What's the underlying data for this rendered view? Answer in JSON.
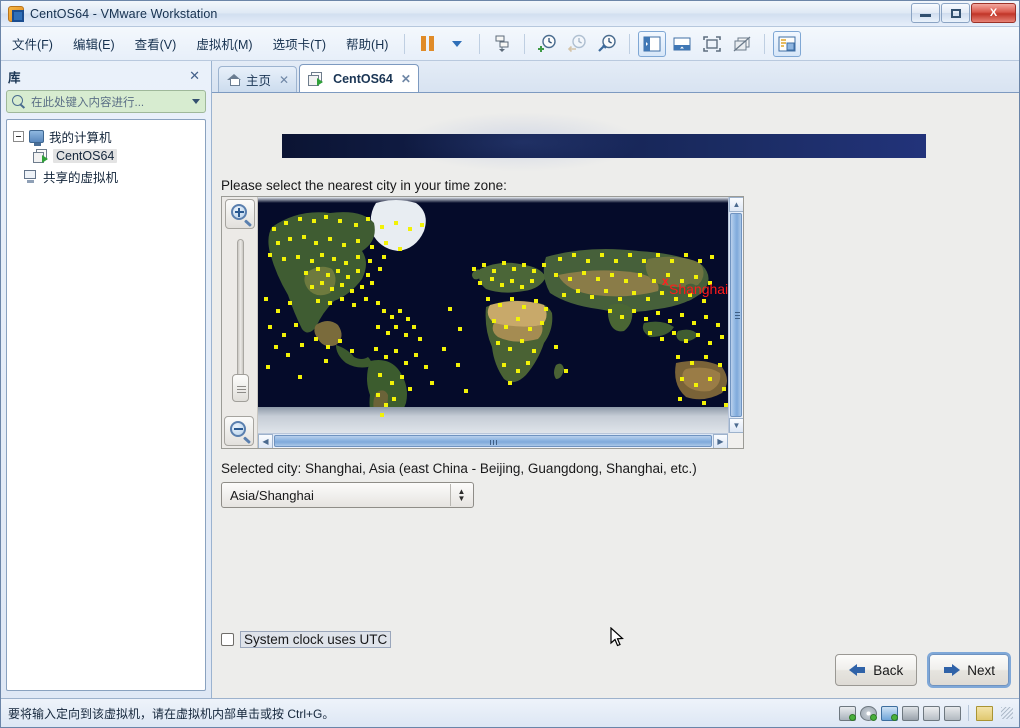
{
  "window": {
    "title": "CentOS64 - VMware Workstation",
    "app_icon": "vmware-icon",
    "minimize_label": "Minimize",
    "maximize_label": "Maximize",
    "close_label": "X"
  },
  "menubar": {
    "items": [
      {
        "label": "文件(F)",
        "name": "menu-file"
      },
      {
        "label": "编辑(E)",
        "name": "menu-edit"
      },
      {
        "label": "查看(V)",
        "name": "menu-view"
      },
      {
        "label": "虚拟机(M)",
        "name": "menu-vm"
      },
      {
        "label": "选项卡(T)",
        "name": "menu-tabs"
      },
      {
        "label": "帮助(H)",
        "name": "menu-help"
      }
    ],
    "toolbar": [
      {
        "name": "pause-button",
        "label": "Pause"
      },
      {
        "name": "pause-dropdown",
        "label": "Pause options"
      },
      {
        "name": "snapshot-take-button",
        "label": "Take snapshot"
      },
      {
        "name": "snapshot-add-button",
        "label": "Add snapshot"
      },
      {
        "name": "snapshot-revert-button",
        "label": "Revert snapshot"
      },
      {
        "name": "snapshot-manager-button",
        "label": "Snapshot manager"
      },
      {
        "name": "show-library-button",
        "label": "Show library"
      },
      {
        "name": "show-thumbnail-bar-button",
        "label": "Show thumbnail bar"
      },
      {
        "name": "full-screen-button",
        "label": "Full screen"
      },
      {
        "name": "unity-button",
        "label": "Unity mode"
      },
      {
        "name": "console-view-button",
        "label": "Console view"
      }
    ]
  },
  "library": {
    "title": "库",
    "close_label": "✕",
    "search_placeholder": "在此处键入内容进行...",
    "tree": [
      {
        "label": "我的计算机",
        "icon": "monitor-icon",
        "level": 1,
        "expanded": true
      },
      {
        "label": "CentOS64",
        "icon": "vm-icon",
        "level": 2,
        "selected": true
      },
      {
        "label": "共享的虚拟机",
        "icon": "shared-vm-icon",
        "level": 1,
        "expanded": false
      }
    ]
  },
  "tabs": [
    {
      "label": "主页",
      "icon": "home-icon",
      "active": false,
      "close": "✕"
    },
    {
      "label": "CentOS64",
      "icon": "vm-icon",
      "active": true,
      "close": "✕"
    }
  ],
  "installer": {
    "prompt": "Please select the nearest city in your time zone:",
    "selected_city_text": "Selected city: Shanghai, Asia (east China - Beijing, Guangdong, Shanghai, etc.)",
    "timezone_value": "Asia/Shanghai",
    "map": {
      "city_marker_label": "Shanghai",
      "marker_glyph": "x",
      "zoom_in_label": "Zoom in",
      "zoom_out_label": "Zoom out",
      "ocean_color": "#050b2a",
      "dot_color": "#f2f207",
      "marker_color": "#ff1a1a"
    },
    "utc_checkbox": {
      "label": "System clock uses UTC",
      "checked": false
    },
    "buttons": {
      "back": "Back",
      "next": "Next"
    }
  },
  "statusbar": {
    "message": "要将输入定向到该虚拟机，请在虚拟机内部单击或按 Ctrl+G。",
    "devices": [
      {
        "name": "hard-disk-icon"
      },
      {
        "name": "cd-dvd-icon"
      },
      {
        "name": "network-adapter-icon"
      },
      {
        "name": "printer-icon"
      },
      {
        "name": "sound-card-icon"
      },
      {
        "name": "usb-device-icon"
      },
      {
        "name": "notes-icon"
      }
    ]
  }
}
